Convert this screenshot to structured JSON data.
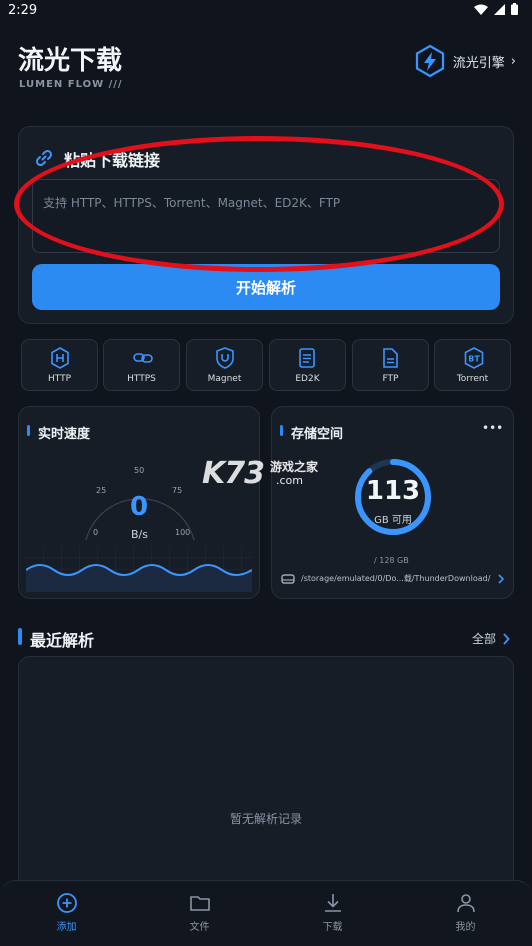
{
  "status": {
    "time": "2:29"
  },
  "header": {
    "title": "流光下载",
    "subtitle": "LUMEN FLOW  ///",
    "engine_label": "流光引擎",
    "engine_chevron": "›"
  },
  "paste": {
    "title": "粘贴下载链接",
    "placeholder": "支持 HTTP、HTTPS、Torrent、Magnet、ED2K、FTP",
    "value": "",
    "button_label": "开始解析"
  },
  "protocols": [
    {
      "label": "HTTP",
      "icon": "http-shield-icon"
    },
    {
      "label": "HTTPS",
      "icon": "link-chain-icon"
    },
    {
      "label": "Magnet",
      "icon": "magnet-shield-icon"
    },
    {
      "label": "ED2K",
      "icon": "document-lines-icon"
    },
    {
      "label": "FTP",
      "icon": "file-icon"
    },
    {
      "label": "Torrent",
      "icon": "bt-badge-icon"
    }
  ],
  "speed": {
    "title": "实时速度",
    "ticks": [
      "0",
      "25",
      "50",
      "75",
      "100"
    ],
    "value": "0",
    "unit": "B/s"
  },
  "storage": {
    "title": "存储空间",
    "menu": "•••",
    "available": "113",
    "available_label": "GB 可用",
    "total": "/ 128 GB",
    "used_fraction": 0.88,
    "path": "/storage/emulated/0/Do...载/ThunderDownload/"
  },
  "recent": {
    "title": "最近解析",
    "see_all": "全部",
    "empty": "暂无解析记录"
  },
  "nav": [
    {
      "label": "添加",
      "icon": "add-circle-icon",
      "active": true
    },
    {
      "label": "文件",
      "icon": "folder-icon",
      "active": false
    },
    {
      "label": "下载",
      "icon": "download-icon",
      "active": false
    },
    {
      "label": "我的",
      "icon": "profile-icon",
      "active": false
    }
  ],
  "watermark": {
    "brand": "K73",
    "sub": "游戏之家",
    "domain": ".com"
  },
  "colors": {
    "accent": "#2c8af3",
    "background": "#10151d",
    "card": "#171d27",
    "annotation": "#e1101a"
  }
}
